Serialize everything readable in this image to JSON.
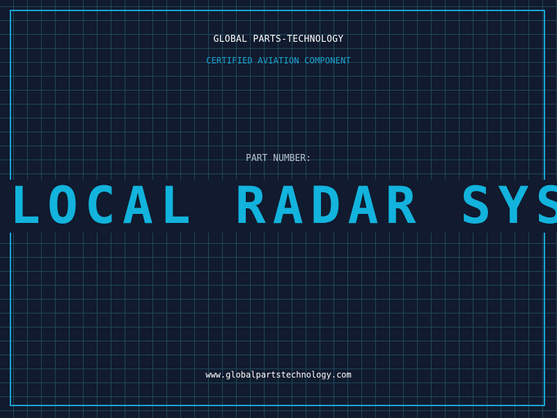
{
  "header": {
    "company": "GLOBAL PARTS-TECHNOLOGY",
    "subtitle": "CERTIFIED AVIATION COMPONENT"
  },
  "part": {
    "label": "PART NUMBER:",
    "name": "LOCAL RADAR SYSTEM"
  },
  "footer": {
    "website": "www.globalpartstechnology.com"
  },
  "colors": {
    "background": "#111a2e",
    "grid": "#1f4a5a",
    "accent": "#1aa6d6",
    "part_name": "#12b3dd",
    "label": "#b8c3cf",
    "text": "#ffffff"
  }
}
